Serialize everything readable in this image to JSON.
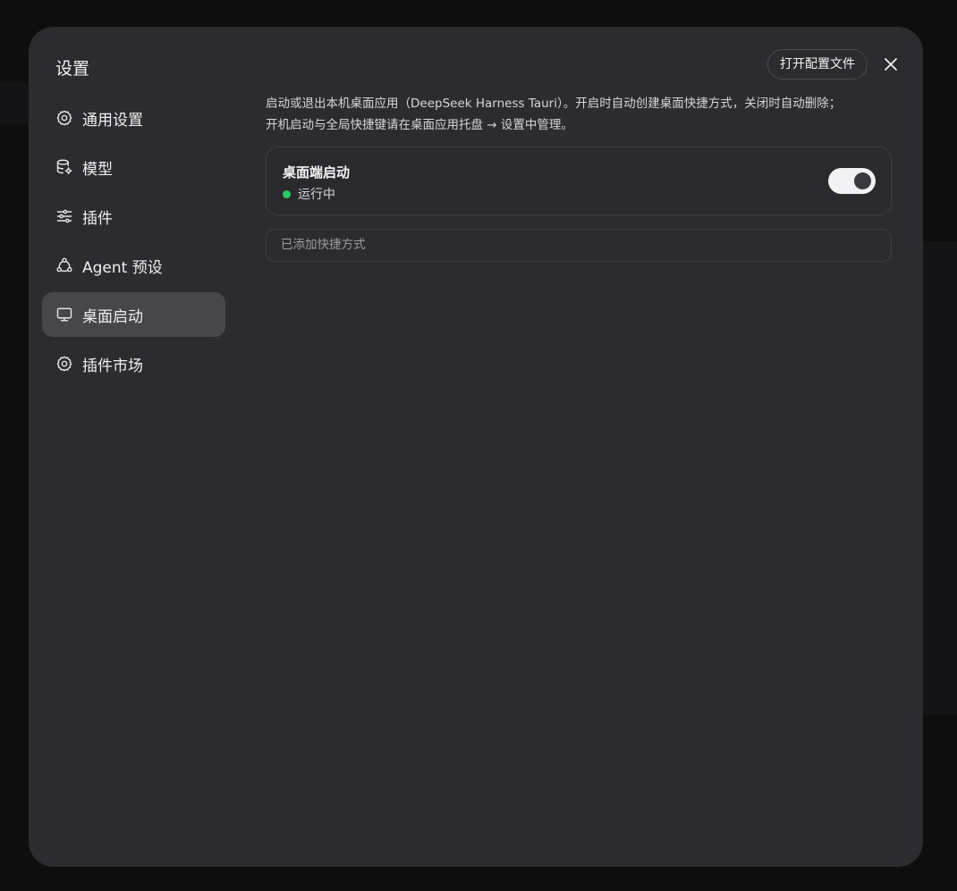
{
  "modal": {
    "title": "设置",
    "open_config_label": "打开配置文件",
    "close_icon": "close-icon"
  },
  "sidebar": {
    "items": [
      {
        "label": "通用设置",
        "icon": "gear-icon",
        "active": false
      },
      {
        "label": "模型",
        "icon": "database-gear-icon",
        "active": false
      },
      {
        "label": "插件",
        "icon": "sliders-icon",
        "active": false
      },
      {
        "label": "Agent 预设",
        "icon": "agent-nodes-icon",
        "active": false
      },
      {
        "label": "桌面启动",
        "icon": "monitor-icon",
        "active": true
      },
      {
        "label": "插件市场",
        "icon": "gear-icon",
        "active": false
      }
    ]
  },
  "content": {
    "description_line1": "启动或退出本机桌面应用（DeepSeek Harness Tauri）。开启时自动创建桌面快捷方式，关闭时自动删除；",
    "description_line2": "开机启动与全局快捷键请在桌面应用托盘 → 设置中管理。",
    "card": {
      "title": "桌面端启动",
      "status": "运行中",
      "status_color": "#2ec866",
      "toggle_on": true
    },
    "shortcut_text": "已添加快捷方式"
  },
  "colors": {
    "modal_bg": "#2c2c2f",
    "active_item_bg": "#46464b",
    "toggle_on_bg": "#f2f2f4"
  }
}
